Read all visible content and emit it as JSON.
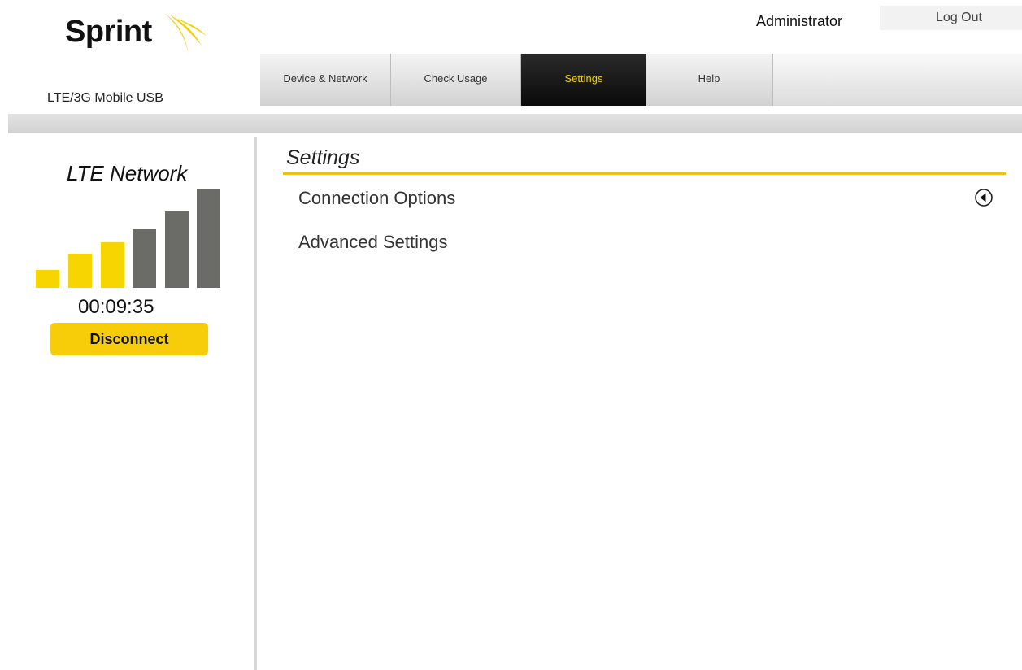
{
  "brand": {
    "name": "Sprint",
    "subtitle": "LTE/3G Mobile USB",
    "colors": {
      "accent": "#f7cd0a",
      "active_tab_bg": "#111111",
      "active_tab_text": "#f0d000"
    }
  },
  "header": {
    "user_label": "Administrator",
    "logout_label": "Log Out"
  },
  "nav": {
    "tabs": [
      {
        "label": "Device & Network",
        "active": false
      },
      {
        "label": "Check Usage",
        "active": false
      },
      {
        "label": "Settings",
        "active": true
      },
      {
        "label": "Help",
        "active": false
      }
    ]
  },
  "status_panel": {
    "network_label": "LTE Network",
    "signal": {
      "bars_total": 6,
      "bars_lit": 3,
      "lit_color": "#f7d500",
      "unlit_color": "#6b6b68"
    },
    "timer": "00:09:35",
    "disconnect_label": "Disconnect"
  },
  "main": {
    "title": "Settings",
    "items": [
      {
        "label": "Connection Options",
        "icon": "expand-arrow-icon"
      },
      {
        "label": "Advanced Settings"
      }
    ]
  }
}
